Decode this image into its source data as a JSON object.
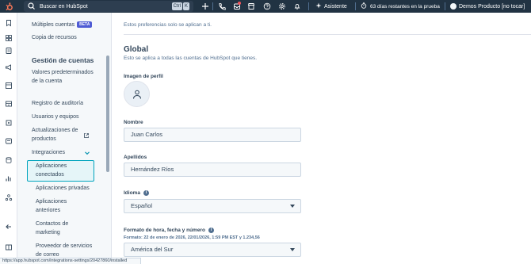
{
  "topbar": {
    "search_placeholder": "Buscar en HubSpot",
    "shortcut_keys": [
      "Ctrl",
      "K"
    ],
    "assistant_label": "Asistente",
    "trial_text": "63 días restantes en la prueba",
    "account_name": "Demos Producto [no tocar]"
  },
  "sidebar": {
    "items_top": [
      {
        "label": "Múltiples cuentas",
        "badge": "BETA"
      },
      {
        "label": "Copia de recursos"
      }
    ],
    "section_title": "Gestión de cuentas",
    "items": [
      {
        "label": "Valores predeterminados de la cuenta"
      },
      {
        "label": "Registro de auditoría"
      },
      {
        "label": "Usuarios y equipos"
      },
      {
        "label": "Actualizaciones de productos"
      },
      {
        "label": "Integraciones"
      }
    ],
    "sub_items": [
      {
        "label": "Aplicaciones conectados",
        "active": true
      },
      {
        "label": "Aplicaciones privadas"
      },
      {
        "label": "Aplicaciones anteriores"
      },
      {
        "label": "Contactos de marketing"
      },
      {
        "label": "Proveedor de servicios de correo"
      }
    ]
  },
  "main": {
    "intro": "Estos preferencias solo se aplican a ti.",
    "global_title": "Global",
    "global_desc": "Esto se aplica a todas las cuentas de HubSpot que tienes.",
    "profile_image_label": "Imagen de perfil",
    "first_name_label": "Nombre",
    "first_name_value": "Juan Carlos",
    "last_name_label": "Apellidos",
    "last_name_value": "Hernández Ríos",
    "language_label": "Idioma",
    "language_value": "Español",
    "format_label": "Formato de hora, fecha y número",
    "format_hint": "Formato: 22 de enero de 2026, 22/01/2026, 1:59 PM EST y 1.234,56",
    "region_value": "América del Sur"
  },
  "status_url": "https://app.hubspot.com/integrations-settings/20427860/installed",
  "colors": {
    "topbar": "#213343",
    "accent": "#00a4bd",
    "brand": "#ff7a59",
    "beta_badge": "#4e5bd4"
  }
}
